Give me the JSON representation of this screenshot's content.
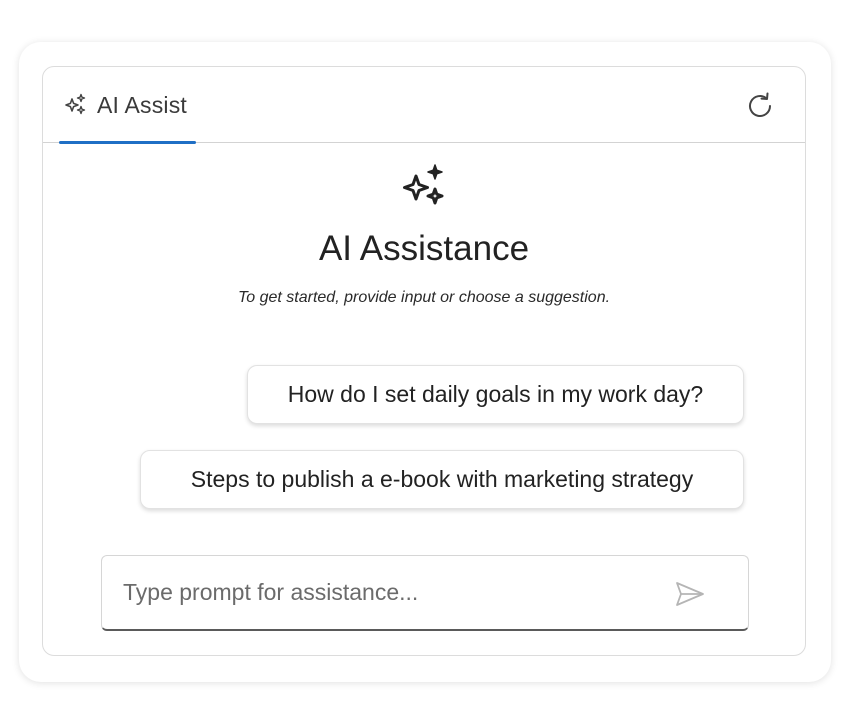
{
  "header": {
    "tab_label": "AI Assist",
    "tab_icon": "sparkle-icon",
    "refresh_icon": "refresh-icon"
  },
  "hero": {
    "icon": "sparkle-icon",
    "title": "AI Assistance",
    "subtitle": "To get started, provide input or choose a suggestion."
  },
  "suggestions": [
    {
      "label": "How do I set daily goals in my work day?"
    },
    {
      "label": "Steps to publish a e-book with marketing strategy"
    }
  ],
  "prompt": {
    "placeholder": "Type prompt for assistance...",
    "value": "",
    "send_icon": "send-icon"
  },
  "colors": {
    "accent": "#1f6fc5",
    "text": "#222222",
    "border": "#dcdcdc"
  }
}
